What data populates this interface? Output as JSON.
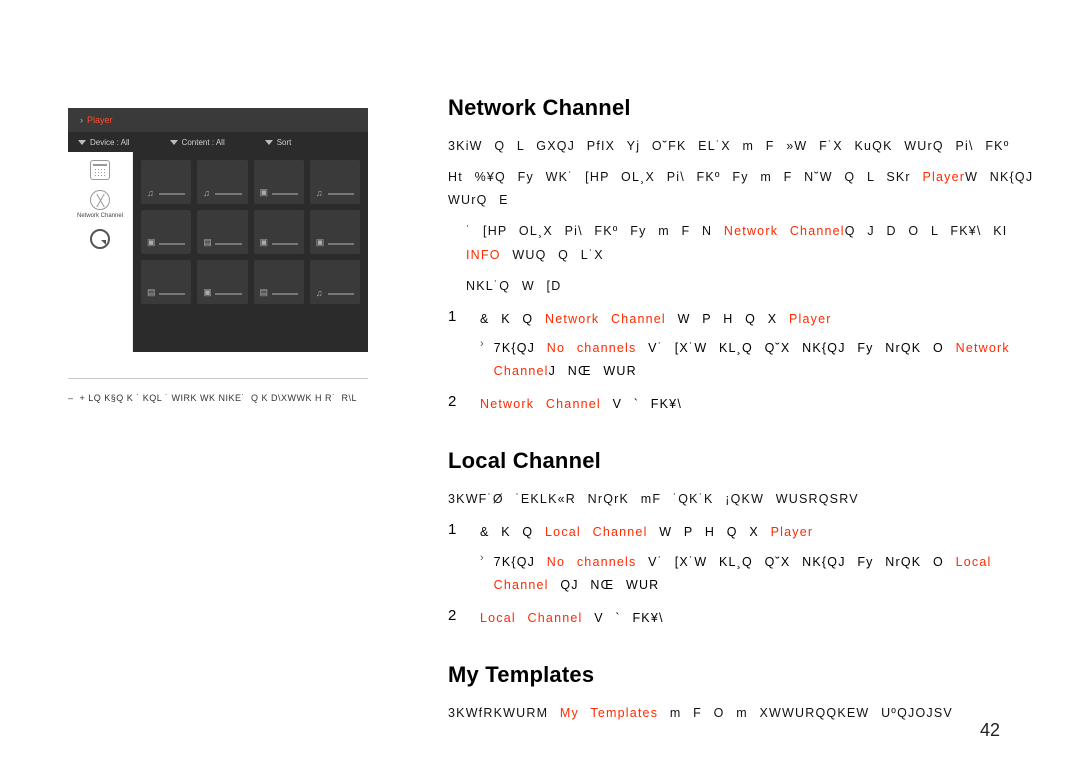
{
  "shot": {
    "crumb": "Player",
    "device_label": "Device : All",
    "content_label": "Content : All",
    "sort_label": "Sort",
    "nav": {
      "item1": "Schedule",
      "item2": "Network Channel",
      "item3": "Local"
    }
  },
  "left_caption": {
    "dash": "–",
    "text": "+ LQ K§Q K ˙ KQL ˙ WIRK WK NIKE˙  Q K D\\XWWK H R˙  R\\L"
  },
  "network": {
    "heading": "Network Channel",
    "p1": "3KiW  Q  L  GXQJ   PfIX  Yj  O˘FK  EL˙X   m F   »W  F˙X  KuQK  WUrQ  Pi\\  FKº",
    "p2_a": "Ht  %¥Q  Fy  WK˙  [HP  OL¸X  Pi\\  FKº  Fy   m F  N˘W  Q  L  SKr ",
    "p2_kw1": "Player",
    "p2_b": "W   NK{QJ  WUrQ  E",
    "p3_a": " ˙  [HP  OL¸X  Pi\\  FKº  Fy   m F  N ",
    "p3_kw1": "Network Channel",
    "p3_b": "Q J D O L FK¥\\  KI",
    "p3_kw2": "INFO",
    "p3_c": "WUQ Q   L˙X",
    "p4": "NKL˙Q W [D",
    "step1_a": "& K  Q ",
    "step1_kw1": "Network Channel",
    "step1_b": " W    P H Q X ",
    "step1_kw2": "Player",
    "step1_sub_a": "7K{QJ ",
    "step1_sub_kw1": "No channels",
    "step1_sub_b": " V˙  [X˙W  KL¸Q  Q˘X  NK{QJ  Fy  NrQK  O ",
    "step1_sub_kw2": "Network Channel",
    "step1_sub_c": "J  NŒ  WUR",
    "step2_kw": "Network Channel",
    "step2_b": " V `  FK¥\\"
  },
  "local": {
    "heading": "Local Channel",
    "p1": "3KWF˙Ø ˙EKLK«R NrQrK mF ˙QK˙K ¡QKW WUSRQSRV",
    "step1_a": "& K  Q ",
    "step1_kw1": "Local Channel",
    "step1_b": " W    P H Q X ",
    "step1_kw2": "Player",
    "step1_sub_a": "7K{QJ ",
    "step1_sub_kw1": "No channels",
    "step1_sub_b": " V˙  [X˙W  KL¸Q  Q˘X  NK{QJ  Fy  NrQK  O ",
    "step1_sub_kw2": "Local Channel",
    "step1_sub_c": " QJ  NŒ  WUR",
    "step2_kw": "Local Channel",
    "step2_b": " V `  FK¥\\"
  },
  "templates": {
    "heading": "My Templates",
    "p1_a": "3KWfRKWURM ",
    "p1_kw": "My Templates",
    "p1_b": " m F  O m XWWURQQKEW UºQJOJSV"
  },
  "page_number": "42"
}
